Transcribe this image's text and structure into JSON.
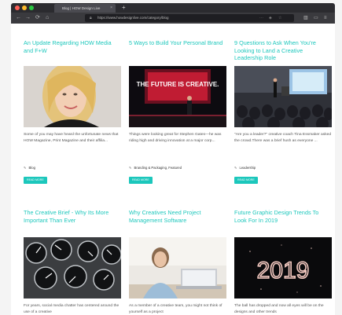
{
  "browser": {
    "tab_title": "Blog | HOW Design Live",
    "url": "https://www.howdesignlive.com/category/blog",
    "back_icon": "back-arrow-icon",
    "forward_icon": "forward-arrow-icon",
    "reload_icon": "reload-icon",
    "home_icon": "home-icon"
  },
  "colors": {
    "accent": "#1cc7bc",
    "chrome": "#2b2b2f"
  },
  "articles": [
    {
      "title": "An Update Regarding HOW Media and F+W",
      "excerpt": "Some of you may have heard the unfortunate news that HOW Magazine, Print Magazine and their affilia...",
      "tags": "Blog",
      "button": "READ MORE"
    },
    {
      "title": "5 Ways to Build Your Personal Brand",
      "excerpt": "Things were looking great for Stephen Gates—he was riding high and driving innovation at a major corp...",
      "tags": "Branding & Packaging, Featured",
      "button": "READ MORE"
    },
    {
      "title": "9 Questions to Ask When You're Looking to Land a Creative Leadership Role",
      "excerpt": "\"Are you a leader?\" creative coach Tina Essmaker asked the crowd.There was a brief hush as everyone ...",
      "tags": "Leadership",
      "button": "READ MORE"
    },
    {
      "title": "The Creative Brief - Why Its More Important Than Ever",
      "excerpt": "For years, social media chatter has centered around the use of a creative"
    },
    {
      "title": "Why Creatives Need Project Management Software",
      "excerpt": "As a member of a creative team, you might not think of yourself as a project"
    },
    {
      "title": "Future Graphic Design Trends To Look For In 2019",
      "excerpt": "The ball has dropped and now all eyes will be on the designs and other trends"
    }
  ],
  "image_texts": {
    "stage_slide": "THE FUTURE IS CREATIVE.",
    "year": "2019"
  }
}
